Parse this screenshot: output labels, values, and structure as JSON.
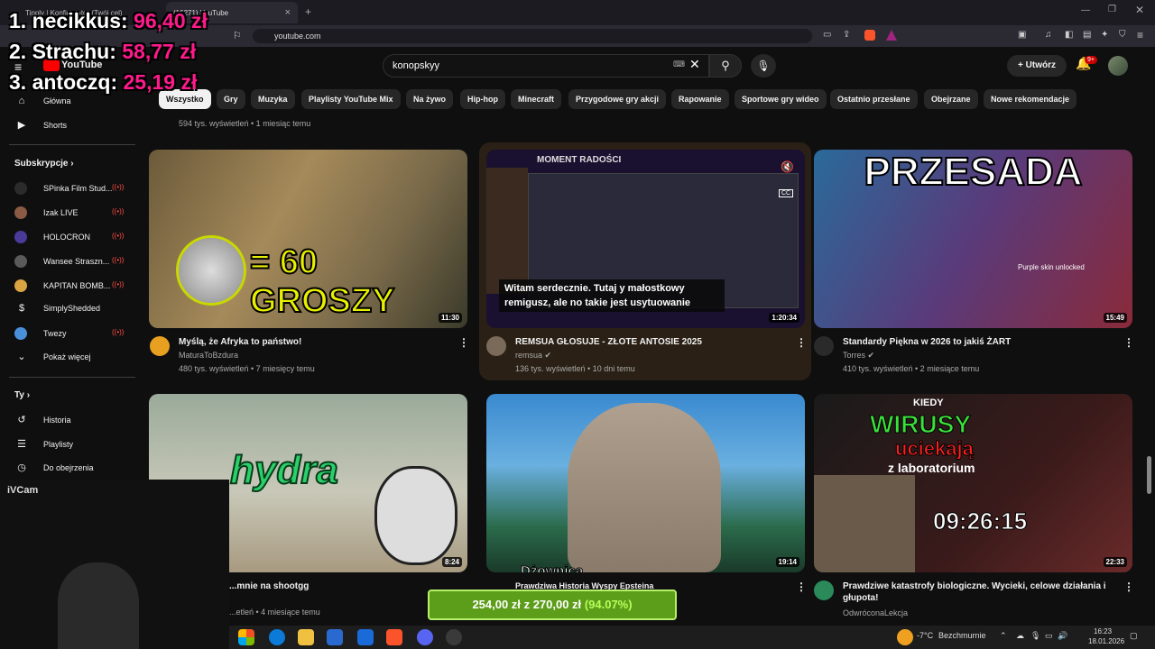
{
  "browser": {
    "tabs": [
      {
        "label": "Tipply | Konfigurator (Twój cel)"
      },
      {
        "label": "(16271) YouTube"
      }
    ],
    "url": "youtube.com"
  },
  "youtube": {
    "logo_text": "YouTube",
    "search_value": "konopskyy",
    "create_label": "Utwórz",
    "notif_badge": "9+"
  },
  "chips": [
    "Wszystko",
    "Gry",
    "Muzyka",
    "Playlisty YouTube Mix",
    "Na żywo",
    "Hip-hop",
    "Minecraft",
    "Przygodowe gry akcji",
    "Rapowanie",
    "Sportowe gry wideo",
    "Ostatnio przesłane",
    "Obejrzane",
    "Nowe rekomendacje"
  ],
  "sidebar": {
    "main": [
      {
        "label": "Główna",
        "icon": "home-icon"
      },
      {
        "label": "Shorts",
        "icon": "shorts-icon"
      }
    ],
    "subs_header": "Subskrypcje",
    "subs": [
      {
        "label": "SPinka Film Stud...",
        "color": "#2b2b2b"
      },
      {
        "label": "Izak LIVE",
        "color": "#8a5a44"
      },
      {
        "label": "HOLOCRON",
        "color": "#4a3a9a"
      },
      {
        "label": "Wansee Straszn...",
        "color": "#5a5a5a"
      },
      {
        "label": "KAPITAN BOMB...",
        "color": "#d9a441"
      },
      {
        "label": "SimplyShedded",
        "color": "#0f0f0f"
      },
      {
        "label": "Twezy",
        "color": "#4a90d9"
      }
    ],
    "show_more": "Pokaż więcej",
    "you_header": "Ty",
    "you": [
      {
        "label": "Historia",
        "icon": "history-icon"
      },
      {
        "label": "Playlisty",
        "icon": "playlist-icon"
      },
      {
        "label": "Do obejrzenia",
        "icon": "watch-later-icon"
      }
    ]
  },
  "top_meta": "594 tys. wyświetleń • 1 miesiąc temu",
  "videos": [
    {
      "title": "Myślą, że Afryka to państwo!",
      "channel": "MaturaToBzdura",
      "meta": "480 tys. wyświetleń • 7 miesięcy temu",
      "duration": "11:30",
      "thumb_text": "= 60 GROSZY"
    },
    {
      "title": "REMSUA GŁOSUJE - ZŁOTE ANTOSIE 2025",
      "channel": "remsua",
      "meta": "136 tys. wyświetleń • 10 dni temu",
      "duration": "1:20:34",
      "thumb_header": "MOMENT RADOŚCI",
      "caption": "Witam serdecznie. Tutaj y małostkowy remigusz, ale no takie jest usytuowanie"
    },
    {
      "title": "Standardy Piękna w 2026 to jakiś ŻART",
      "channel": "Torres",
      "meta": "410 tys. wyświetleń • 2 miesiące temu",
      "duration": "15:49",
      "thumb_text": "PRZESADA",
      "thumb_sub": "Purple skin unlocked"
    },
    {
      "title": "...mnie na shootgg",
      "channel": "",
      "meta": "...etleń • 4 miesiące temu",
      "duration": "8:24",
      "thumb_text": "hydra"
    },
    {
      "title": "Prawdziwa Historia Wyspy Epsteina",
      "channel": "",
      "meta": "",
      "duration": "19:14",
      "thumb_text": "Dżownica"
    },
    {
      "title": "Prawdziwe katastrofy biologiczne. Wycieki, celowe działania i głupota!",
      "channel": "OdwróconaLekcja",
      "meta": "",
      "duration": "22:33",
      "thumb_kiedy": "KIEDY",
      "thumb_wirusy": "WIRUSY",
      "thumb_uciekaja": "uciekają",
      "thumb_lab": "z laboratorium",
      "thumb_time": "09:26:15"
    }
  ],
  "overlay": {
    "donors": [
      {
        "name": "1. necikkus:",
        "amount": "96,40 zł"
      },
      {
        "name": "2. Strachu:",
        "amount": "58,77 zł"
      },
      {
        "name": "3. antoczq:",
        "amount": "25,19 zł"
      }
    ],
    "goal": {
      "current": "254,00 zł",
      "sep": "z",
      "target": "270,00 zł",
      "percent": "(94.07%)",
      "fraction": 0.9407
    },
    "cam_label": "iVCam"
  },
  "taskbar": {
    "weather": "-7°C",
    "weather_desc": "Bezchmurnie",
    "time": "16:23",
    "date": "18.01.2026"
  }
}
